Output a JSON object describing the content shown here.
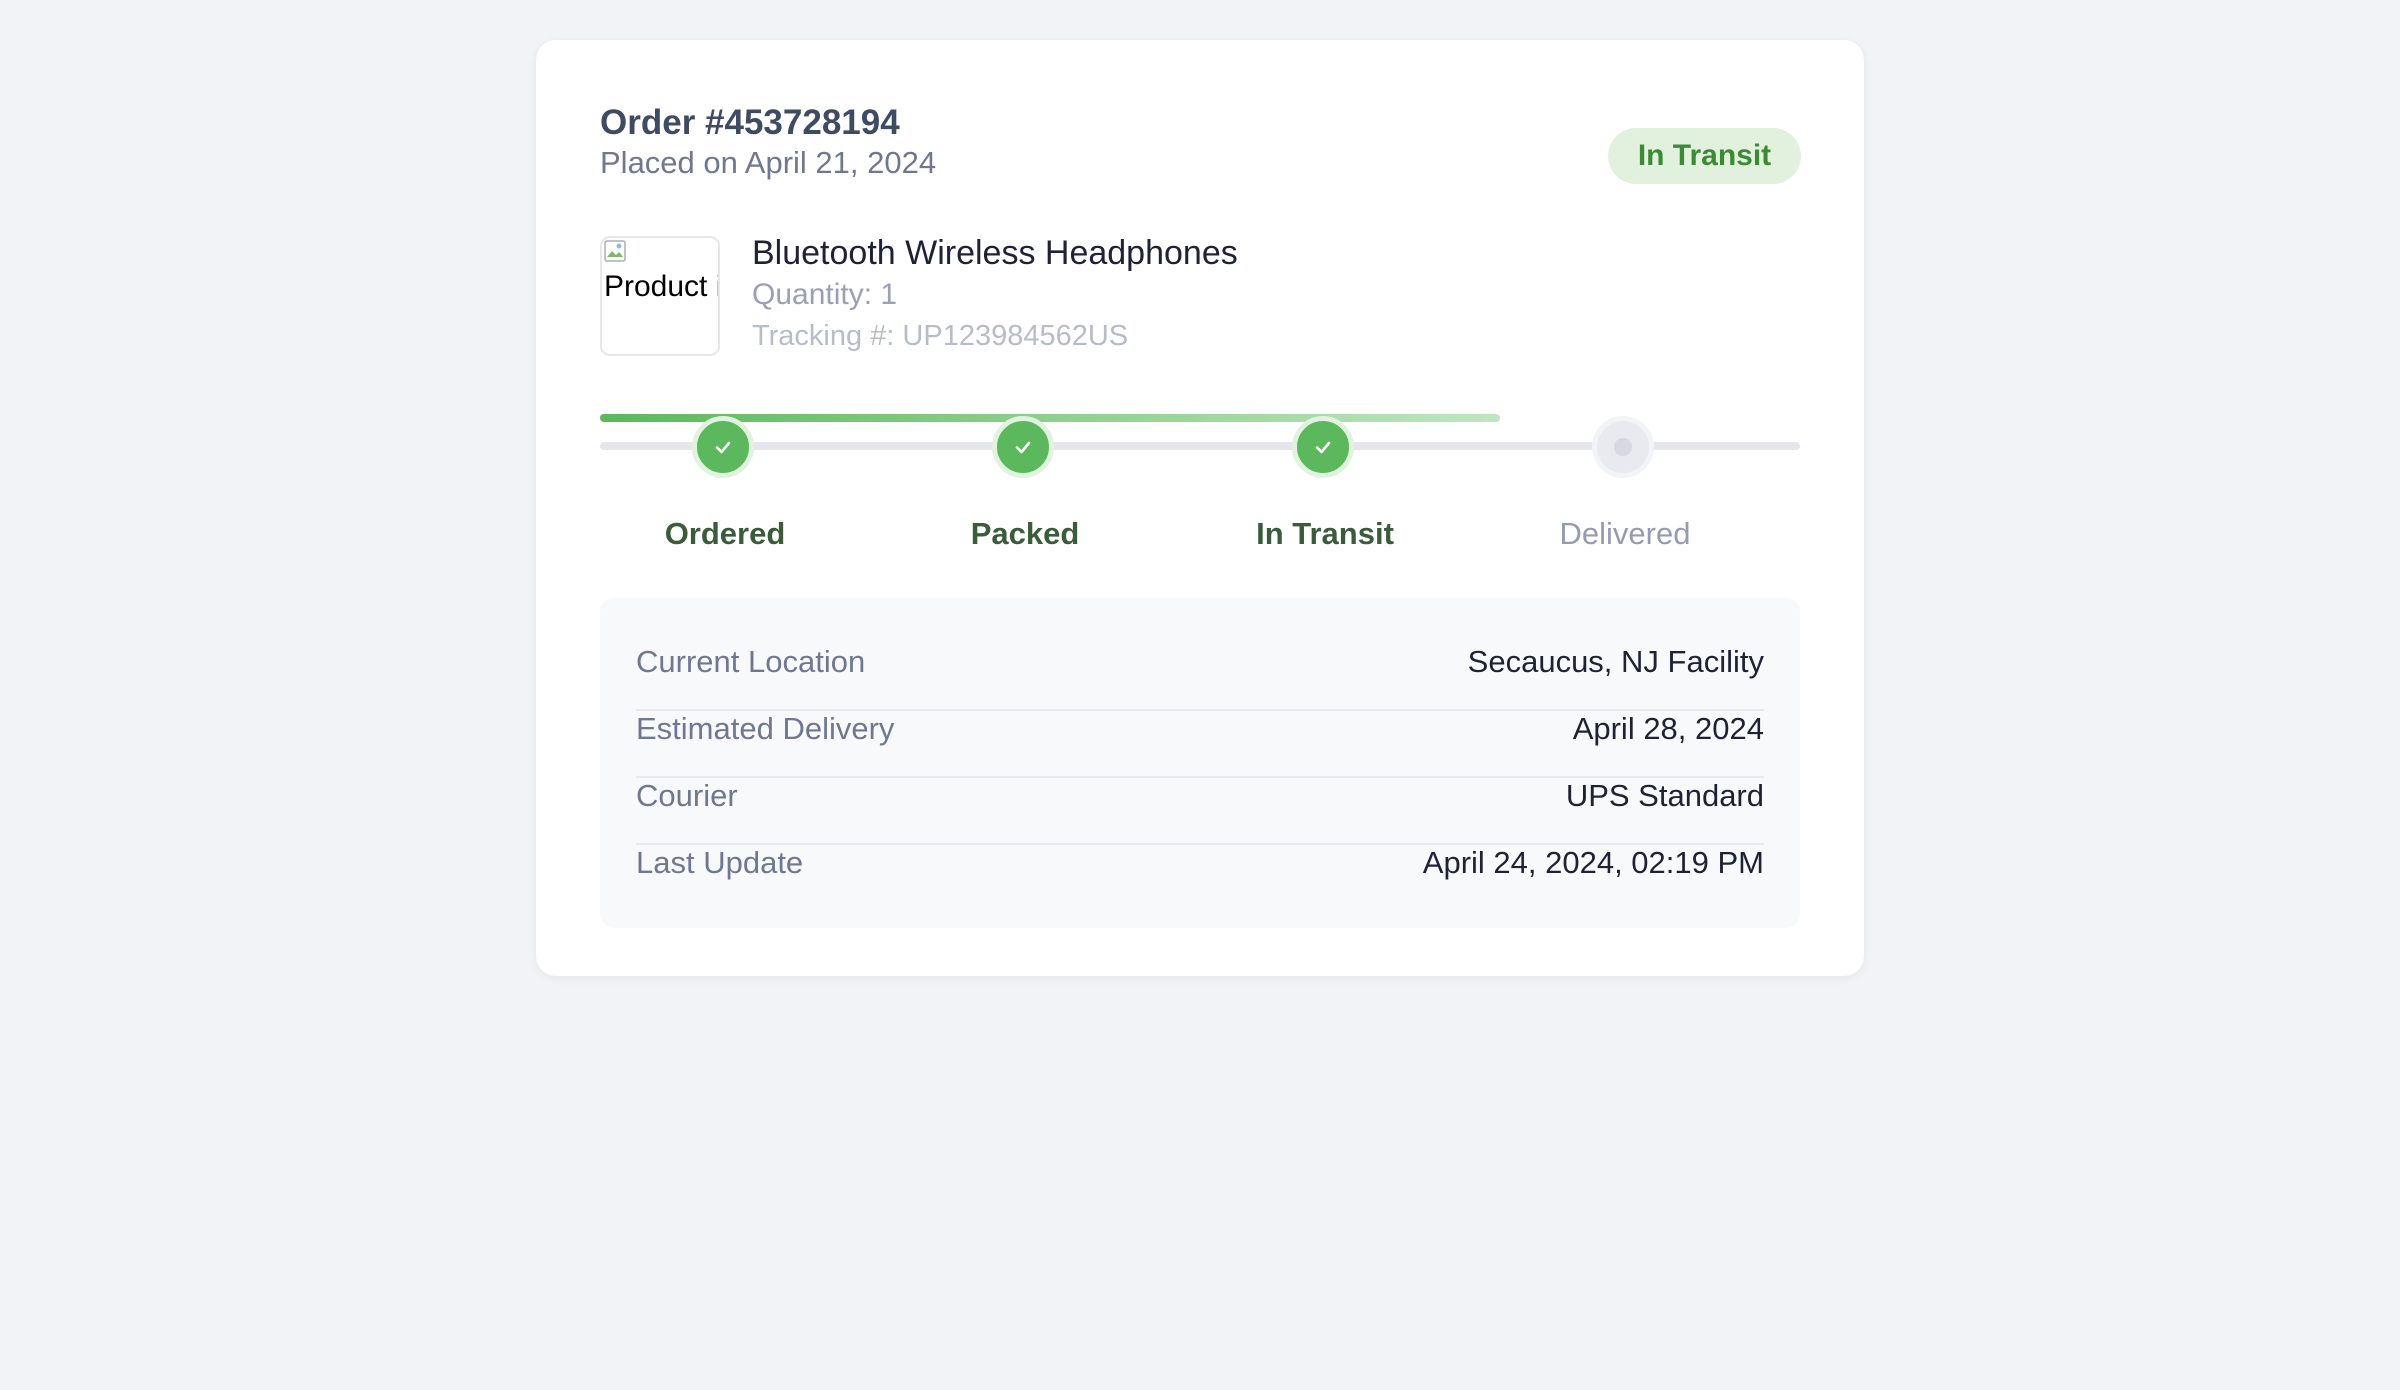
{
  "order": {
    "title": "Order #453728194",
    "placed": "Placed on April 21, 2024",
    "status": "In Transit"
  },
  "product": {
    "image_alt": "Product image",
    "image_icon": "broken-image-icon",
    "name": "Bluetooth Wireless Headphones",
    "quantity": "Quantity: 1",
    "tracking": "Tracking #: UP123984562US"
  },
  "progress": {
    "completed_fraction": 0.75,
    "steps": [
      {
        "label": "Ordered",
        "state": "completed",
        "icon": "check-icon"
      },
      {
        "label": "Packed",
        "state": "completed",
        "icon": "check-icon"
      },
      {
        "label": "In Transit",
        "state": "completed",
        "icon": "check-icon"
      },
      {
        "label": "Delivered",
        "state": "pending",
        "icon": "pending-dot-icon"
      }
    ]
  },
  "details": [
    {
      "label": "Current Location",
      "value": "Secaucus, NJ Facility"
    },
    {
      "label": "Estimated Delivery",
      "value": "April 28, 2024"
    },
    {
      "label": "Courier",
      "value": "UPS Standard"
    },
    {
      "label": "Last Update",
      "value": "April 24, 2024, 02:19 PM"
    }
  ],
  "colors": {
    "page_background": "#f1f3f6",
    "card_background": "#ffffff",
    "accent_green": "#5cb85c",
    "status_badge_background": "#e2f1de",
    "status_badge_text": "#3c8a35",
    "completed_label": "#3a5c3a",
    "pending_label": "#959bb1"
  }
}
